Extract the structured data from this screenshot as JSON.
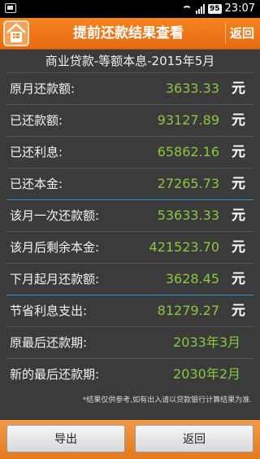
{
  "status_bar": {
    "battery": "95",
    "time": "23:07"
  },
  "header": {
    "title": "提前还款结果查看",
    "back_label": "返回"
  },
  "subtitle": "商业贷款-等额本息-2015年5月",
  "rows": [
    {
      "label": "原月还款额:",
      "value": "3633.33",
      "unit": "元"
    },
    {
      "label": "已还款额:",
      "value": "93127.89",
      "unit": "元"
    },
    {
      "label": "已还利息:",
      "value": "65862.16",
      "unit": "元"
    },
    {
      "label": "已还本金:",
      "value": "27265.73",
      "unit": "元"
    },
    {
      "label": "该月一次还款额:",
      "value": "53633.33",
      "unit": "元"
    },
    {
      "label": "该月后剩余本金:",
      "value": "421523.70",
      "unit": "元"
    },
    {
      "label": "下月起月还款额:",
      "value": "3628.45",
      "unit": "元"
    },
    {
      "label": "节省利息支出:",
      "value": "81279.27",
      "unit": "元"
    },
    {
      "label": "原最后还款期:",
      "value": "2033年3月"
    },
    {
      "label": "新的最后还款期:",
      "value": "2030年2月"
    }
  ],
  "note": "*结果仅供参考,如有出入请以贷款银行计算结果为准.",
  "footer": {
    "export_label": "导出",
    "back_label": "返回"
  }
}
